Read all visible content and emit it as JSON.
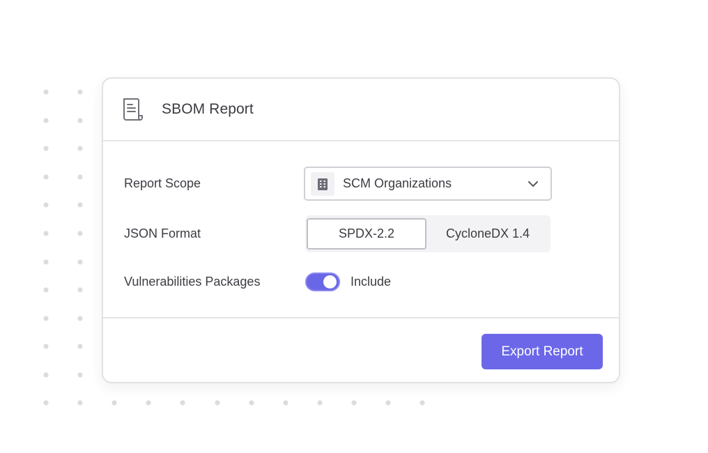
{
  "card": {
    "title": "SBOM Report",
    "icon": "document-icon"
  },
  "report_scope": {
    "label": "Report Scope",
    "value": "SCM Organizations",
    "icon": "building-icon"
  },
  "json_format": {
    "label": "JSON Format",
    "options": [
      "SPDX-2.2",
      "CycloneDX 1.4"
    ],
    "selected": "SPDX-2.2"
  },
  "vulnerabilities": {
    "label": "Vulnerabilities Packages",
    "toggle_on": true,
    "toggle_text": "Include"
  },
  "actions": {
    "export_label": "Export Report"
  },
  "colors": {
    "accent": "#6b67e8",
    "border": "#e2e2e6",
    "dot": "#dcdce0"
  }
}
